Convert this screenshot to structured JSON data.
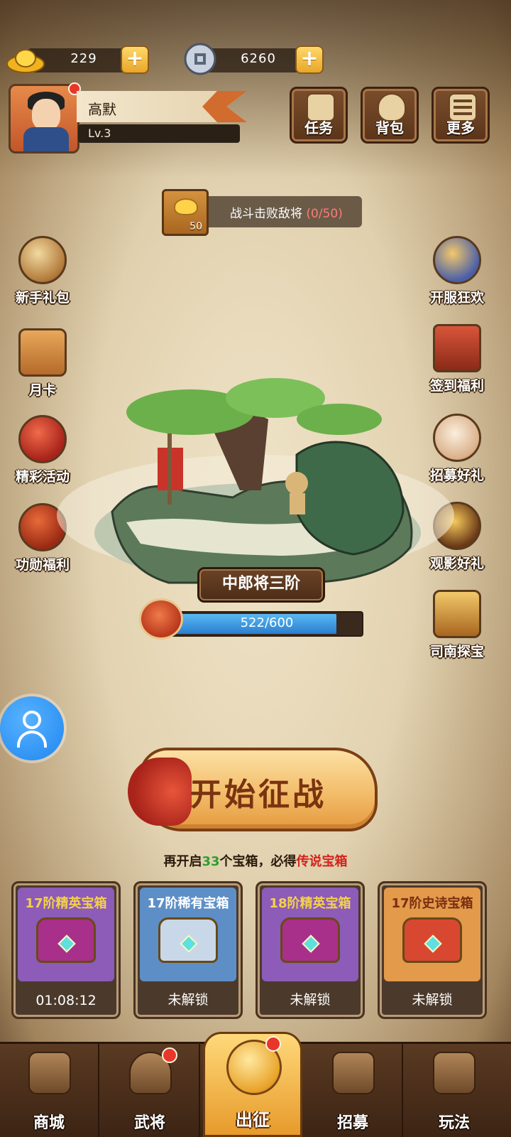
{
  "currency": {
    "gold": {
      "icon": "gold-ingot-icon",
      "value": "229"
    },
    "coins": {
      "icon": "copper-coin-icon",
      "value": "6260"
    }
  },
  "player": {
    "name": "高默",
    "level": "Lv.3"
  },
  "top_buttons": [
    {
      "label": "任务",
      "icon": "scroll-icon"
    },
    {
      "label": "背包",
      "icon": "bag-icon"
    },
    {
      "label": "更多",
      "icon": "menu-icon"
    }
  ],
  "quest": {
    "reward_count": "50",
    "text": "战斗击败敌将",
    "progress": "(0/50)"
  },
  "left_icons": [
    {
      "label": "新手礼包",
      "icon": "novice-pack-icon"
    },
    {
      "label": "月卡",
      "icon": "month-card-icon"
    },
    {
      "label": "精彩活动",
      "icon": "events-icon"
    },
    {
      "label": "功勋福利",
      "icon": "merit-welfare-icon"
    }
  ],
  "right_icons": [
    {
      "label": "开服狂欢",
      "icon": "server-carnival-icon"
    },
    {
      "label": "签到福利",
      "icon": "checkin-icon"
    },
    {
      "label": "招募好礼",
      "icon": "recruit-gift-icon"
    },
    {
      "label": "观影好礼",
      "icon": "video-gift-icon"
    },
    {
      "label": "司南探宝",
      "icon": "compass-treasure-icon"
    }
  ],
  "stage": {
    "rank": "中郎将三阶",
    "xp_text": "522/600",
    "xp_fraction": 0.87
  },
  "start_button": {
    "label": "开始征战"
  },
  "hint": {
    "prefix": "再开启",
    "count": "33",
    "middle": "个宝箱，必得",
    "reward": "传说宝箱"
  },
  "chests": [
    {
      "title": "17阶精英宝箱",
      "status": "01:08:12",
      "theme_color": "#8d5bb8",
      "title_color": "#f3d24a",
      "box_color": "#a8308a"
    },
    {
      "title": "17阶稀有宝箱",
      "status": "未解锁",
      "theme_color": "#5d8fc6",
      "title_color": "#ffffff",
      "box_color": "#c8d8e8"
    },
    {
      "title": "18阶精英宝箱",
      "status": "未解锁",
      "theme_color": "#8d5bb8",
      "title_color": "#f3d24a",
      "box_color": "#a8308a"
    },
    {
      "title": "17阶史诗宝箱",
      "status": "未解锁",
      "theme_color": "#e39a4a",
      "title_color": "#7a2e12",
      "box_color": "#d84830"
    }
  ],
  "nav": [
    {
      "label": "商城",
      "icon": "shop-icon",
      "active": false
    },
    {
      "label": "武将",
      "icon": "general-icon",
      "active": false
    },
    {
      "label": "出征",
      "icon": "battle-icon",
      "active": true
    },
    {
      "label": "招募",
      "icon": "recruit-icon",
      "active": false
    },
    {
      "label": "玩法",
      "icon": "gameplay-icon",
      "active": false
    }
  ]
}
